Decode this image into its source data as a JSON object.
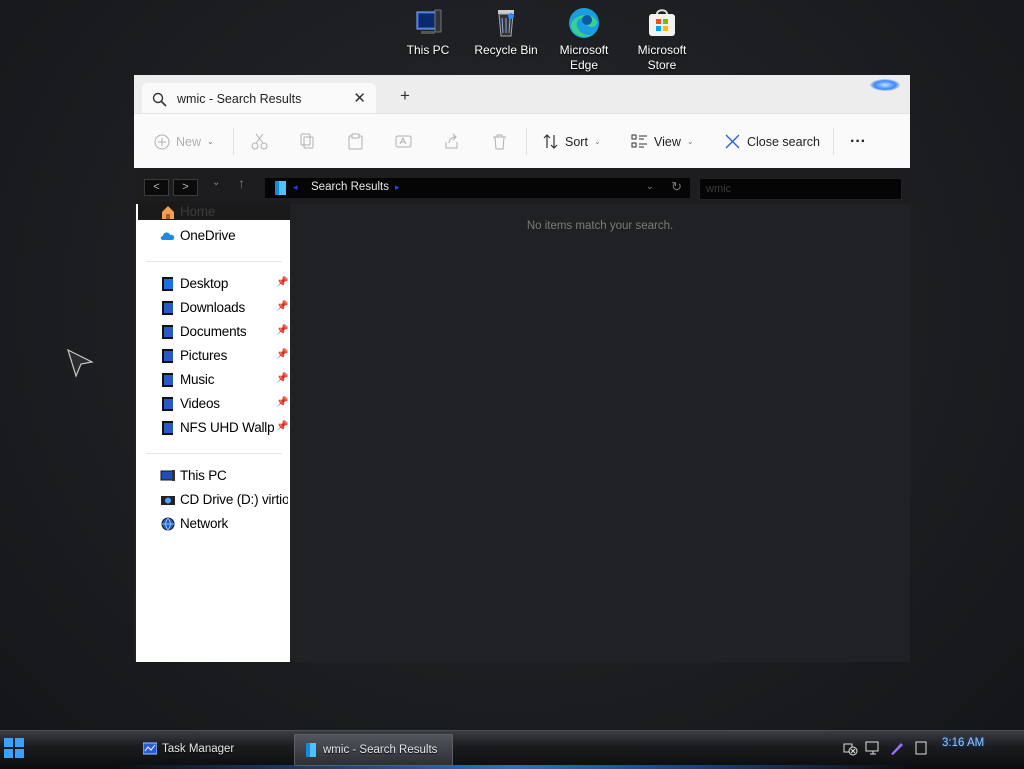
{
  "desktop": {
    "icons": [
      {
        "label": "This PC",
        "icon": "this-pc-icon"
      },
      {
        "label": "Recycle Bin",
        "icon": "recycle-bin-icon"
      },
      {
        "label": "Microsoft Edge",
        "icon": "edge-icon"
      },
      {
        "label": "Microsoft Store",
        "icon": "store-icon"
      }
    ]
  },
  "window": {
    "tab_title": "wmic - Search Results",
    "new_tab_glyph": "+",
    "close_tab_glyph": "✕",
    "toolbar": {
      "new_label": "New",
      "sort_label": "Sort",
      "view_label": "View",
      "close_search_label": "Close search",
      "more_glyph": "···"
    },
    "address": {
      "location": "Search Results",
      "search_value": "wmic"
    },
    "nav_pane": {
      "top": [
        {
          "label": "Home",
          "icon": "home-icon"
        },
        {
          "label": "OneDrive",
          "icon": "onedrive-icon"
        }
      ],
      "pinned": [
        {
          "label": "Desktop",
          "icon": "desktop-folder-icon"
        },
        {
          "label": "Downloads",
          "icon": "downloads-folder-icon"
        },
        {
          "label": "Documents",
          "icon": "documents-folder-icon"
        },
        {
          "label": "Pictures",
          "icon": "pictures-folder-icon"
        },
        {
          "label": "Music",
          "icon": "music-folder-icon"
        },
        {
          "label": "Videos",
          "icon": "videos-folder-icon"
        },
        {
          "label": "NFS UHD Wallpapers",
          "icon": "folder-icon"
        }
      ],
      "devices": [
        {
          "label": "This PC",
          "icon": "this-pc-icon"
        },
        {
          "label": "CD Drive (D:) virtio-win",
          "icon": "cd-drive-icon"
        },
        {
          "label": "Network",
          "icon": "network-icon"
        }
      ]
    },
    "empty_message": "No items match your search."
  },
  "taskbar": {
    "items": [
      {
        "label": "Task Manager",
        "icon": "task-manager-icon"
      },
      {
        "label": "wmic - Search Results",
        "icon": "file-explorer-icon"
      }
    ],
    "clock": "3:16 AM"
  },
  "colors": {
    "accent": "#3aa1ff",
    "window_dark": "#202124",
    "toolbar_light": "#fafafa"
  }
}
